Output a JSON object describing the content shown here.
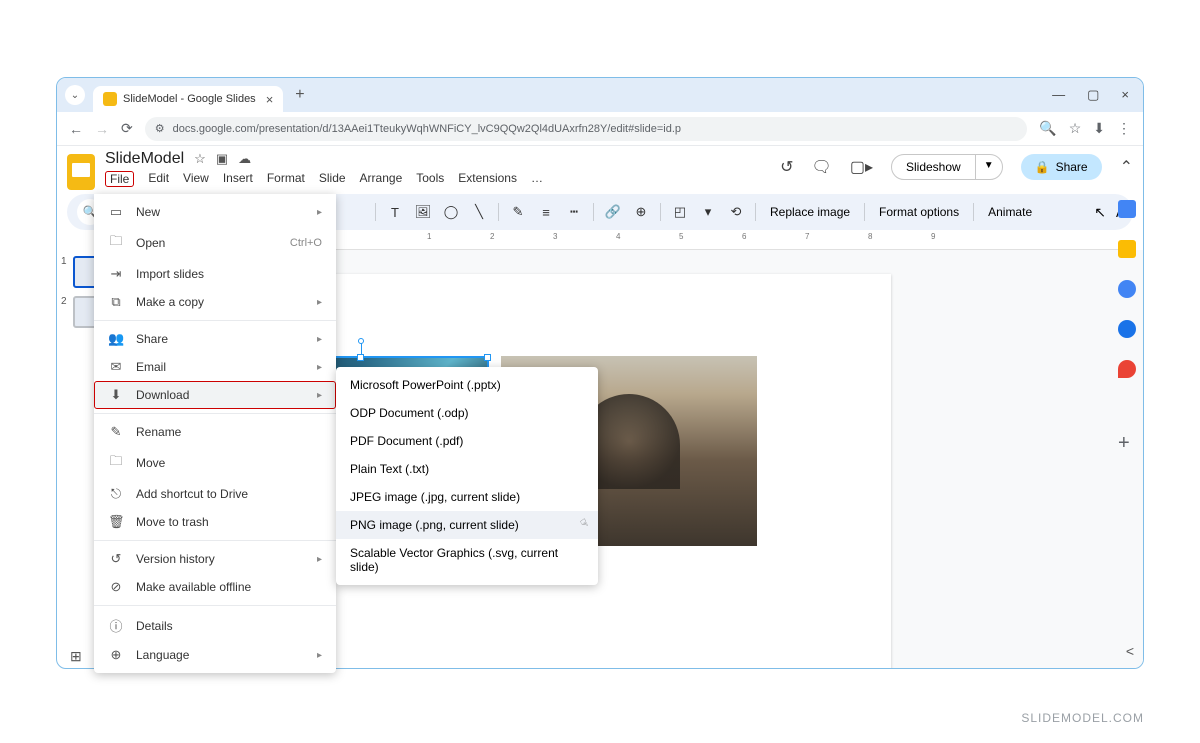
{
  "browser": {
    "tab_title": "SlideModel - Google Slides",
    "url": "docs.google.com/presentation/d/13AAei1TteukyWqhWNFiCY_lvC9QQw2Ql4dUAxrfn28Y/edit#slide=id.p"
  },
  "app": {
    "doc_title": "SlideModel",
    "menubar": [
      "File",
      "Edit",
      "View",
      "Insert",
      "Format",
      "Slide",
      "Arrange",
      "Tools",
      "Extensions",
      "…"
    ],
    "slideshow": "Slideshow",
    "share": "Share"
  },
  "toolbar": {
    "replace_image": "Replace image",
    "format_options": "Format options",
    "animate": "Animate"
  },
  "ruler": [
    "1",
    "2",
    "3",
    "4",
    "5",
    "6",
    "7",
    "8",
    "9"
  ],
  "thumbs": [
    "1",
    "2"
  ],
  "file_menu": {
    "new": "New",
    "open": "Open",
    "open_shortcut": "Ctrl+O",
    "import_slides": "Import slides",
    "make_copy": "Make a copy",
    "share": "Share",
    "email": "Email",
    "download": "Download",
    "rename": "Rename",
    "move": "Move",
    "add_shortcut": "Add shortcut to Drive",
    "move_trash": "Move to trash",
    "version_history": "Version history",
    "make_offline": "Make available offline",
    "details": "Details",
    "language": "Language"
  },
  "download_submenu": [
    "Microsoft PowerPoint (.pptx)",
    "ODP Document (.odp)",
    "PDF Document (.pdf)",
    "Plain Text (.txt)",
    "JPEG image (.jpg, current slide)",
    "PNG image (.png, current slide)",
    "Scalable Vector Graphics (.svg, current slide)"
  ],
  "watermark": "SLIDEMODEL.COM"
}
